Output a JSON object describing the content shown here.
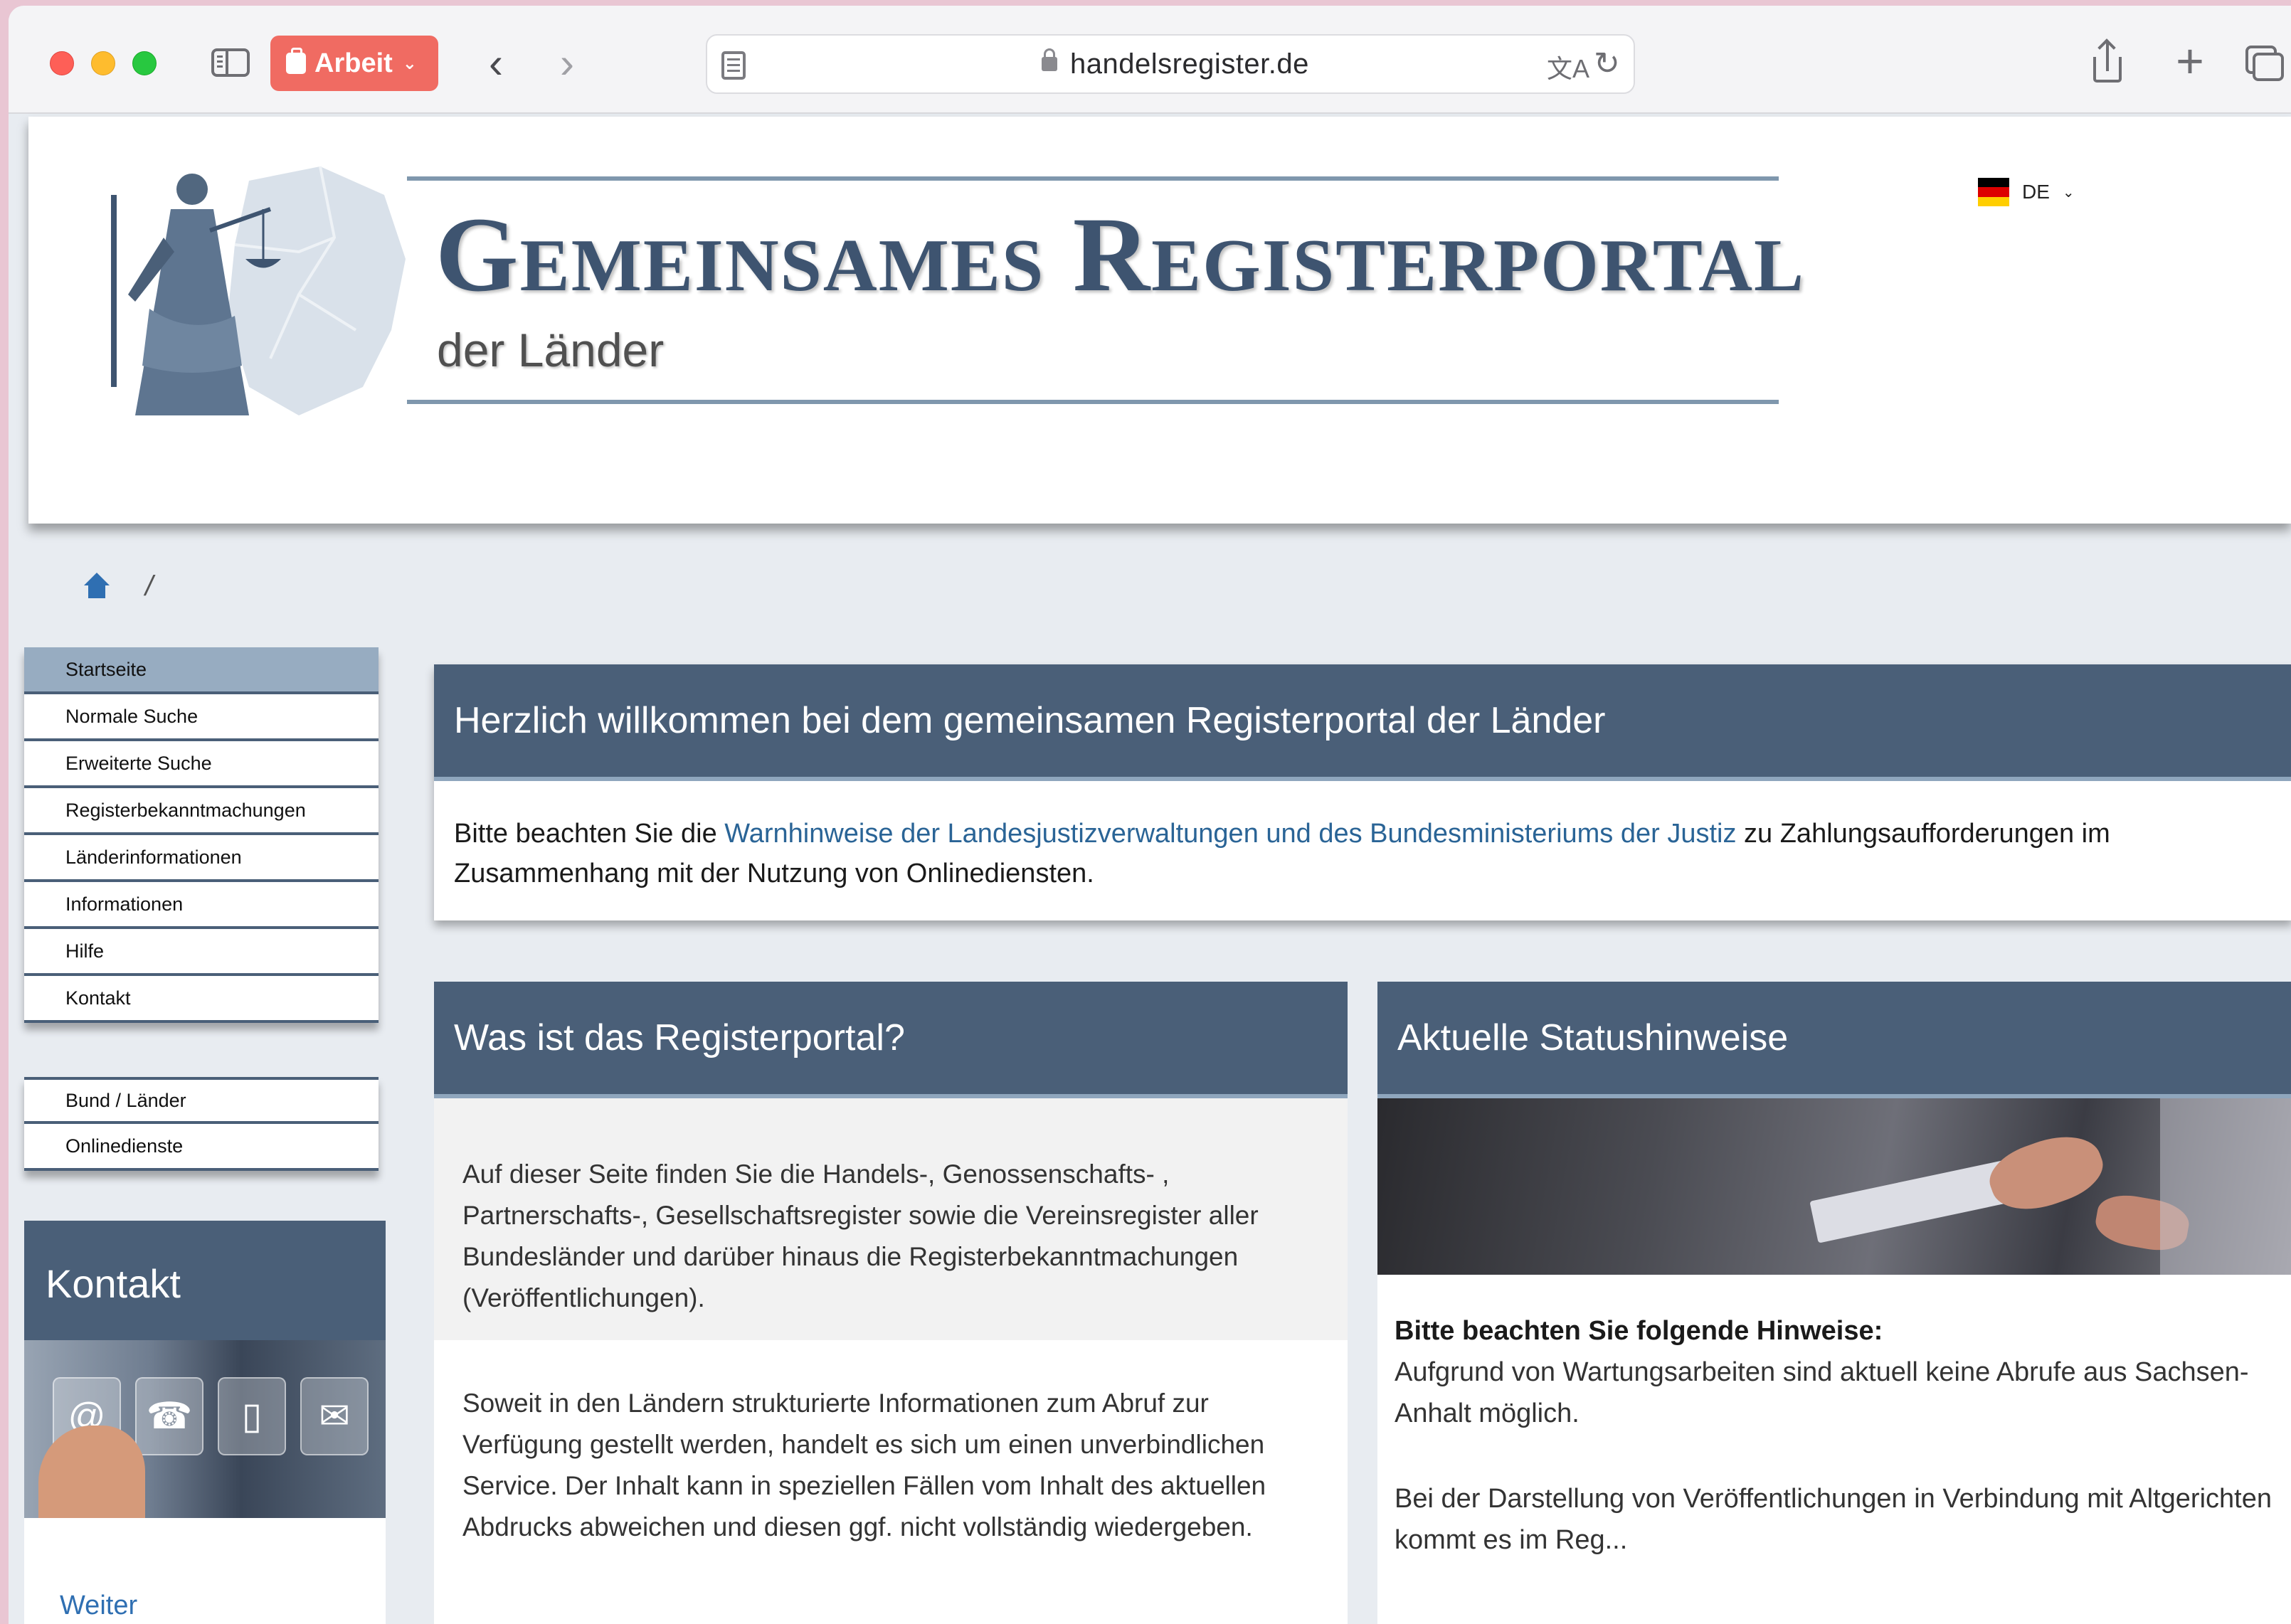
{
  "browser": {
    "profile_label": "Arbeit",
    "url": "handelsregister.de",
    "colors": {
      "profile": "#f06b62"
    }
  },
  "header": {
    "brand_title": "Gemeinsames Registerportal",
    "brand_sub": "der Länder",
    "language": "DE"
  },
  "breadcrumb": {
    "separator": "/"
  },
  "menu": {
    "items": [
      "Startseite",
      "Normale Suche",
      "Erweiterte Suche",
      "Registerbekanntmachungen",
      "Länderinformationen",
      "Informationen",
      "Hilfe",
      "Kontakt"
    ],
    "active": "Startseite",
    "secondary": [
      "Bund / Länder",
      "Onlinedienste"
    ]
  },
  "kontakt": {
    "title": "Kontakt",
    "tiles": [
      "@",
      "☎",
      "▯",
      "✉"
    ],
    "link": "Weiter"
  },
  "welcome": {
    "title": "Herzlich willkommen bei dem gemeinsamen Registerportal der Länder",
    "text_before": "Bitte beachten Sie die ",
    "link": "Warnhinweise der Landesjustizverwaltungen und des Bundesministeriums der Justiz",
    "text_after": " zu Zahlungsaufforderungen im Zusammenhang mit der Nutzung von Onlinediensten."
  },
  "what": {
    "title": "Was ist das Registerportal?",
    "p1": "Auf dieser Seite finden Sie die Handels-, Genossenschafts- , Partnerschafts-, Gesellschaftsregister sowie die Vereinsregister aller Bundesländer und darüber hinaus die Registerbekanntmachungen (Veröffentlichungen).",
    "p2": "Soweit in den Ländern strukturierte Informationen zum Abruf zur Verfügung gestellt werden, handelt es sich um einen unverbindlichen Service. Der Inhalt kann in speziellen Fällen vom Inhalt des aktuellen Abdrucks abweichen und diesen ggf. nicht vollständig wiedergeben."
  },
  "status": {
    "title": "Aktuelle Statushinweise",
    "heading": "Bitte beachten Sie folgende Hinweise:",
    "p1": "Aufgrund von Wartungsarbeiten sind aktuell keine Abrufe aus Sachsen-Anhalt möglich.",
    "p2": "Bei der Darstellung von Veröffentlichungen in Verbindung mit Altgerichten kommt es im Reg..."
  }
}
